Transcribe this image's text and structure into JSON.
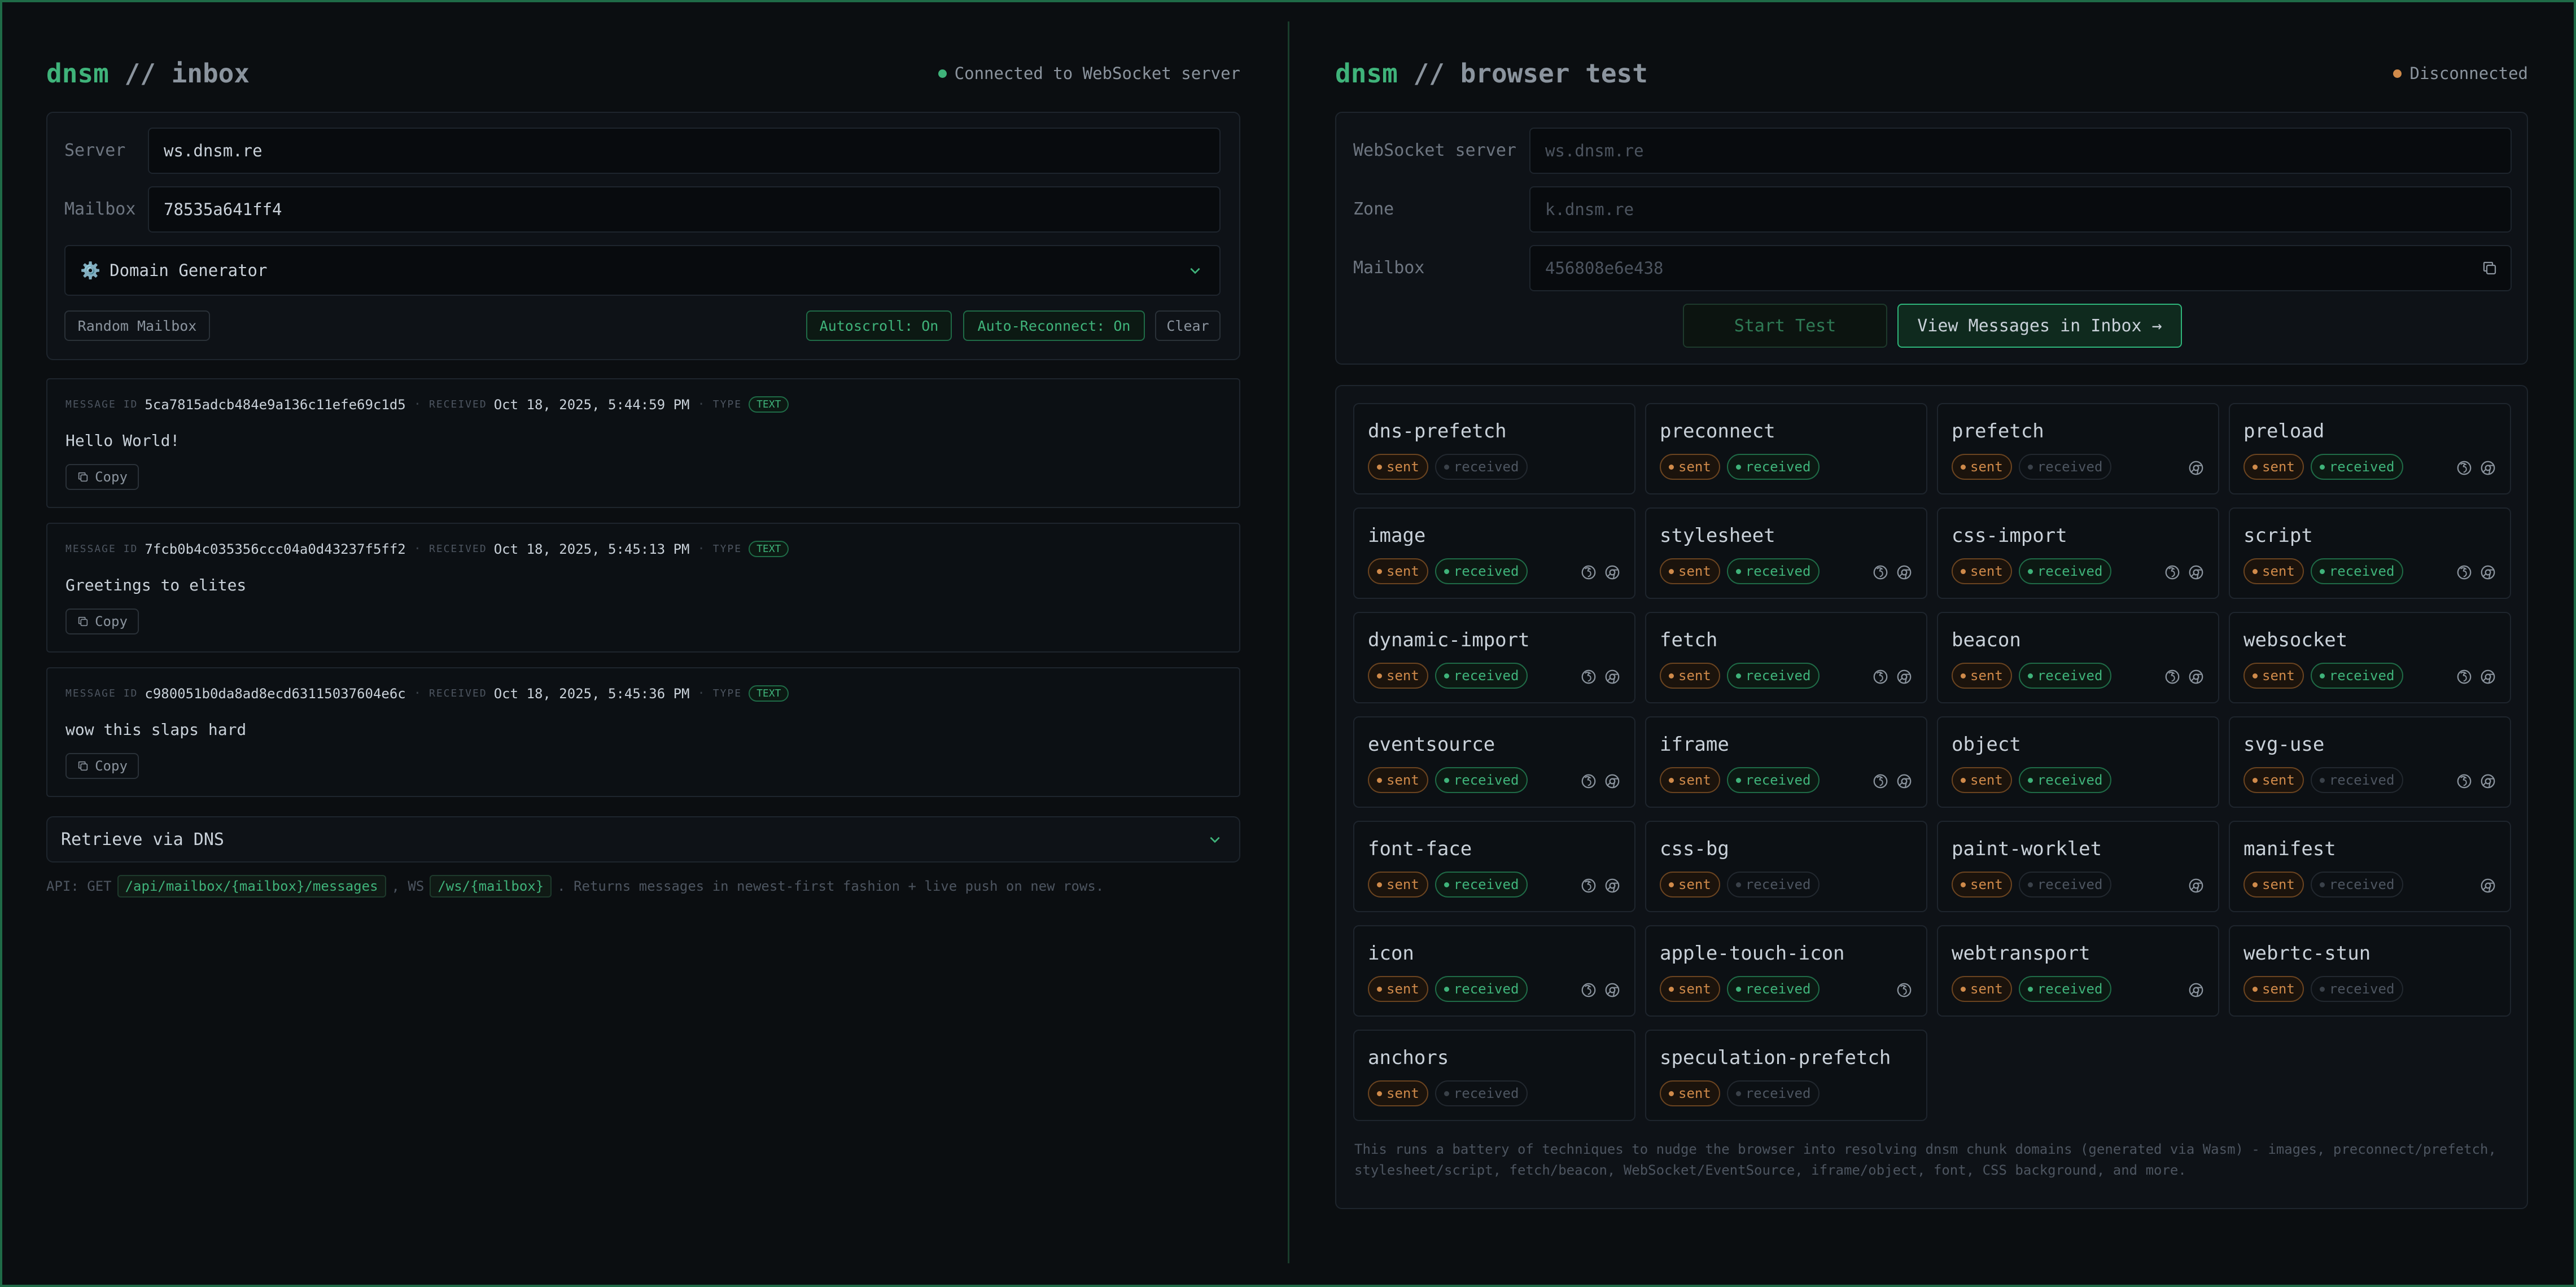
{
  "inbox": {
    "brand": "dnsm",
    "title": "// inbox",
    "status": {
      "text": "Connected to WebSocket server",
      "color": "#3fb37a"
    },
    "server": {
      "label": "Server",
      "value": "ws.dnsm.re"
    },
    "mailbox": {
      "label": "Mailbox",
      "value": "78535a641ff4"
    },
    "generator": {
      "icon": "⚙️",
      "label": "Domain Generator"
    },
    "buttons": {
      "random": "Random Mailbox",
      "autoscroll": "Autoscroll: On",
      "reconnect": "Auto-Reconnect: On",
      "clear": "Clear"
    },
    "meta_labels": {
      "id": "MESSAGE ID",
      "received": "RECEIVED",
      "type": "TYPE"
    },
    "copy_label": "Copy",
    "messages": [
      {
        "id": "5ca7815adcb484e9a136c11efe69c1d5",
        "received": "Oct 18, 2025, 5:44:59 PM",
        "type": "TEXT",
        "body": "Hello World!"
      },
      {
        "id": "7fcb0b4c035356ccc04a0d43237f5ff2",
        "received": "Oct 18, 2025, 5:45:13 PM",
        "type": "TEXT",
        "body": "Greetings to elites"
      },
      {
        "id": "c980051b0da8ad8ecd63115037604e6c",
        "received": "Oct 18, 2025, 5:45:36 PM",
        "type": "TEXT",
        "body": "wow this slaps hard"
      }
    ],
    "dns_section": "Retrieve via DNS",
    "api": {
      "prefix": "API: GET",
      "path": "/api/mailbox/{mailbox}/messages",
      "mid": ", WS",
      "ws": "/ws/{mailbox}",
      "suffix": ". Returns messages in newest-first fashion + live push on new rows."
    }
  },
  "test": {
    "brand": "dnsm",
    "title": "// browser test",
    "status": {
      "text": "Disconnected",
      "color": "#d08a4a"
    },
    "ws_field": {
      "label": "WebSocket server",
      "placeholder": "ws.dnsm.re"
    },
    "zone_field": {
      "label": "Zone",
      "placeholder": "k.dnsm.re"
    },
    "mailbox_field": {
      "label": "Mailbox",
      "value": "456808e6e438"
    },
    "start_button": "Start Test",
    "view_button": "View Messages in Inbox →",
    "sent_label": "sent",
    "received_label": "received",
    "techniques": [
      {
        "name": "dns-prefetch",
        "received": false,
        "browsers": []
      },
      {
        "name": "preconnect",
        "received": true,
        "browsers": []
      },
      {
        "name": "prefetch",
        "received": false,
        "browsers": [
          "chrome"
        ]
      },
      {
        "name": "preload",
        "received": true,
        "browsers": [
          "firefox",
          "chrome"
        ]
      },
      {
        "name": "image",
        "received": true,
        "browsers": [
          "firefox",
          "chrome"
        ]
      },
      {
        "name": "stylesheet",
        "received": true,
        "browsers": [
          "firefox",
          "chrome"
        ]
      },
      {
        "name": "css-import",
        "received": true,
        "browsers": [
          "firefox",
          "chrome"
        ]
      },
      {
        "name": "script",
        "received": true,
        "browsers": [
          "firefox",
          "chrome"
        ]
      },
      {
        "name": "dynamic-import",
        "received": true,
        "browsers": [
          "firefox",
          "chrome"
        ]
      },
      {
        "name": "fetch",
        "received": true,
        "browsers": [
          "firefox",
          "chrome"
        ]
      },
      {
        "name": "beacon",
        "received": true,
        "browsers": [
          "firefox",
          "chrome"
        ]
      },
      {
        "name": "websocket",
        "received": true,
        "browsers": [
          "firefox",
          "chrome"
        ]
      },
      {
        "name": "eventsource",
        "received": true,
        "browsers": [
          "firefox",
          "chrome"
        ]
      },
      {
        "name": "iframe",
        "received": true,
        "browsers": [
          "firefox",
          "chrome"
        ]
      },
      {
        "name": "object",
        "received": true,
        "browsers": []
      },
      {
        "name": "svg-use",
        "received": false,
        "browsers": [
          "firefox",
          "chrome"
        ]
      },
      {
        "name": "font-face",
        "received": true,
        "browsers": [
          "firefox",
          "chrome"
        ]
      },
      {
        "name": "css-bg",
        "received": false,
        "browsers": []
      },
      {
        "name": "paint-worklet",
        "received": false,
        "browsers": [
          "chrome"
        ]
      },
      {
        "name": "manifest",
        "received": false,
        "browsers": [
          "chrome"
        ]
      },
      {
        "name": "icon",
        "received": true,
        "browsers": [
          "firefox",
          "chrome"
        ]
      },
      {
        "name": "apple-touch-icon",
        "received": true,
        "browsers": [
          "firefox"
        ]
      },
      {
        "name": "webtransport",
        "received": true,
        "browsers": [
          "chrome"
        ]
      },
      {
        "name": "webrtc-stun",
        "received": false,
        "browsers": []
      },
      {
        "name": "anchors",
        "received": false,
        "browsers": []
      },
      {
        "name": "speculation-prefetch",
        "received": false,
        "browsers": []
      }
    ],
    "note": "This runs a battery of techniques to nudge the browser into resolving dnsm chunk domains (generated via Wasm) - images, preconnect/prefetch, stylesheet/script, fetch/beacon, WebSocket/EventSource, iframe/object, font, CSS background, and more."
  }
}
